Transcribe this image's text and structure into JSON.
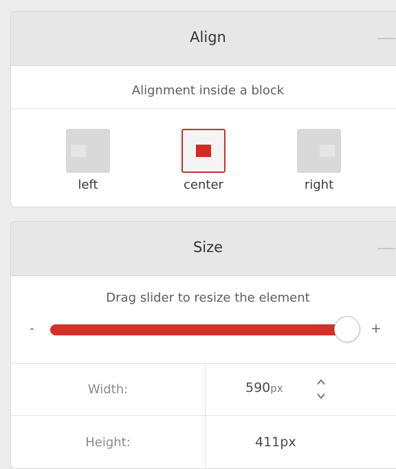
{
  "align": {
    "title": "Align",
    "subtitle": "Alignment inside a block",
    "options": [
      {
        "label": "left",
        "selected": false
      },
      {
        "label": "center",
        "selected": true
      },
      {
        "label": "right",
        "selected": false
      }
    ]
  },
  "size": {
    "title": "Size",
    "subtitle": "Drag slider to resize the element",
    "slider_min_label": "-",
    "slider_max_label": "+",
    "slider_level_fraction": 1.0,
    "width": {
      "label": "Width:",
      "value": "590",
      "unit": "px"
    },
    "height": {
      "label": "Height:",
      "value": "411px"
    }
  },
  "colors": {
    "accent": "#d4302a",
    "header_bg": "#e7e7e7",
    "page_bg": "#ececec"
  }
}
